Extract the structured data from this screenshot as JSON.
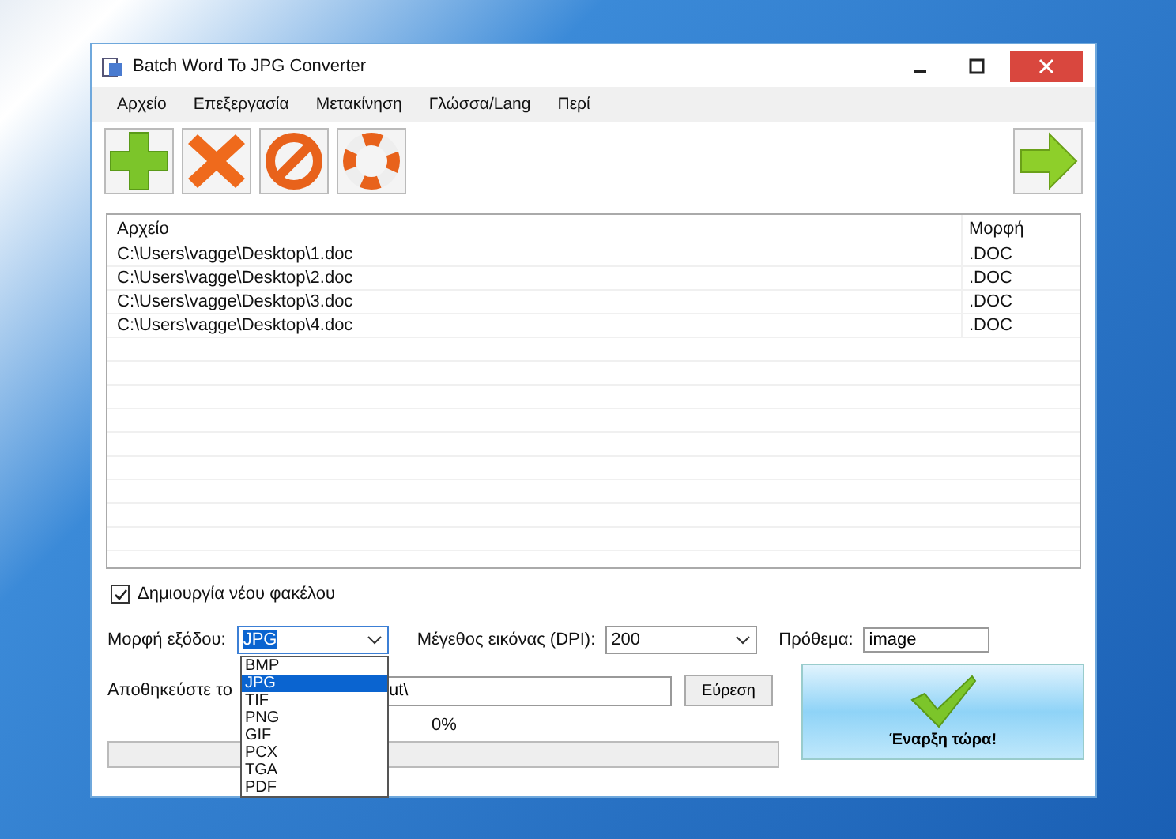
{
  "window": {
    "title": "Batch Word To JPG Converter"
  },
  "menu": [
    "Αρχείο",
    "Επεξεργασία",
    "Μετακίνηση",
    "Γλώσσα/Lang",
    "Περί"
  ],
  "file_list": {
    "columns": [
      "Αρχείο",
      "Μορφή"
    ],
    "rows": [
      [
        "C:\\Users\\vagge\\Desktop\\1.doc",
        ".DOC"
      ],
      [
        "C:\\Users\\vagge\\Desktop\\2.doc",
        ".DOC"
      ],
      [
        "C:\\Users\\vagge\\Desktop\\3.doc",
        ".DOC"
      ],
      [
        "C:\\Users\\vagge\\Desktop\\4.doc",
        ".DOC"
      ]
    ]
  },
  "create_folder": {
    "label": "Δημιουργία νέου φακέλου",
    "checked": true
  },
  "output_format": {
    "label": "Μορφή εξόδου:",
    "value": "JPG",
    "options": [
      {
        "label": "BMP",
        "selected": false
      },
      {
        "label": "JPG",
        "selected": true
      },
      {
        "label": "TIF",
        "selected": false
      },
      {
        "label": "PNG",
        "selected": false
      },
      {
        "label": "GIF",
        "selected": false
      },
      {
        "label": "PCX",
        "selected": false
      },
      {
        "label": "TGA",
        "selected": false
      },
      {
        "label": "PDF",
        "selected": false
      }
    ]
  },
  "dpi": {
    "label": "Μέγεθος εικόνας (DPI):",
    "value": "200"
  },
  "prefix": {
    "label": "Πρόθεμα:",
    "value": "image"
  },
  "save_to": {
    "label": "Αποθηκεύστε το",
    "value": "ut\\"
  },
  "browse_button": "Εύρεση",
  "progress": {
    "reading": "0%",
    "level": 0
  },
  "start_button": "Έναρξη τώρα!"
}
